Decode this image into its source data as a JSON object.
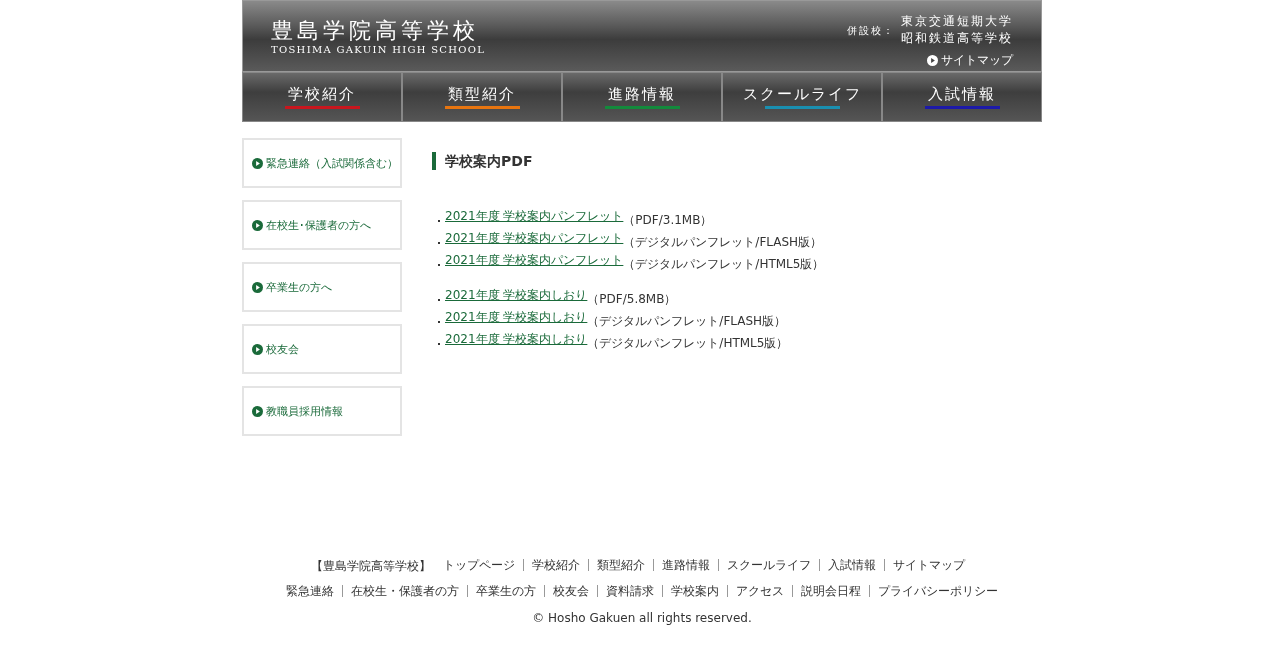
{
  "header": {
    "school_name": "豊島学院高等学校",
    "school_name_en": "TOSHIMA GAKUIN HIGH SCHOOL",
    "affiliates_label": "併設校：",
    "affiliates": [
      "東京交通短期大学",
      "昭和鉄道高等学校"
    ],
    "sitemap_link": "サイトマップ"
  },
  "nav": [
    {
      "label": "学校紹介",
      "color": "#c8161e"
    },
    {
      "label": "類型紹介",
      "color": "#e8750f"
    },
    {
      "label": "進路情報",
      "color": "#138a3c"
    },
    {
      "label": "スクールライフ",
      "color": "#1a8fb0"
    },
    {
      "label": "入試情報",
      "color": "#1d1aa8"
    }
  ],
  "sidebar": [
    {
      "label": "緊急連絡（入試関係含む）"
    },
    {
      "label": "在校生･保護者の方へ"
    },
    {
      "label": "卒業生の方へ"
    },
    {
      "label": "校友会"
    },
    {
      "label": "教職員採用情報"
    }
  ],
  "content": {
    "title": "学校案内PDF",
    "groups": [
      [
        {
          "link": "2021年度 学校案内パンフレット",
          "note": "（PDF/3.1MB）"
        },
        {
          "link": "2021年度 学校案内パンフレット",
          "note": "（デジタルパンフレット/FLASH版）"
        },
        {
          "link": "2021年度 学校案内パンフレット",
          "note": "（デジタルパンフレット/HTML5版）"
        }
      ],
      [
        {
          "link": "2021年度 学校案内しおり",
          "note": "（PDF/5.8MB）"
        },
        {
          "link": "2021年度 学校案内しおり",
          "note": "（デジタルパンフレット/FLASH版）"
        },
        {
          "link": "2021年度 学校案内しおり",
          "note": "（デジタルパンフレット/HTML5版）"
        }
      ]
    ]
  },
  "footer": {
    "site_label": "【豊島学院高等学校】",
    "row_1": [
      "トップページ",
      "学校紹介",
      "類型紹介",
      "進路情報",
      "スクールライフ",
      "入試情報",
      "サイトマップ"
    ],
    "row_2": [
      "緊急連絡",
      "在校生・保護者の方",
      "卒業生の方",
      "校友会",
      "資料請求",
      "学校案内",
      "アクセス",
      "説明会日程",
      "プライバシーポリシー"
    ],
    "copyright": "© Hosho Gakuen all rights reserved."
  }
}
